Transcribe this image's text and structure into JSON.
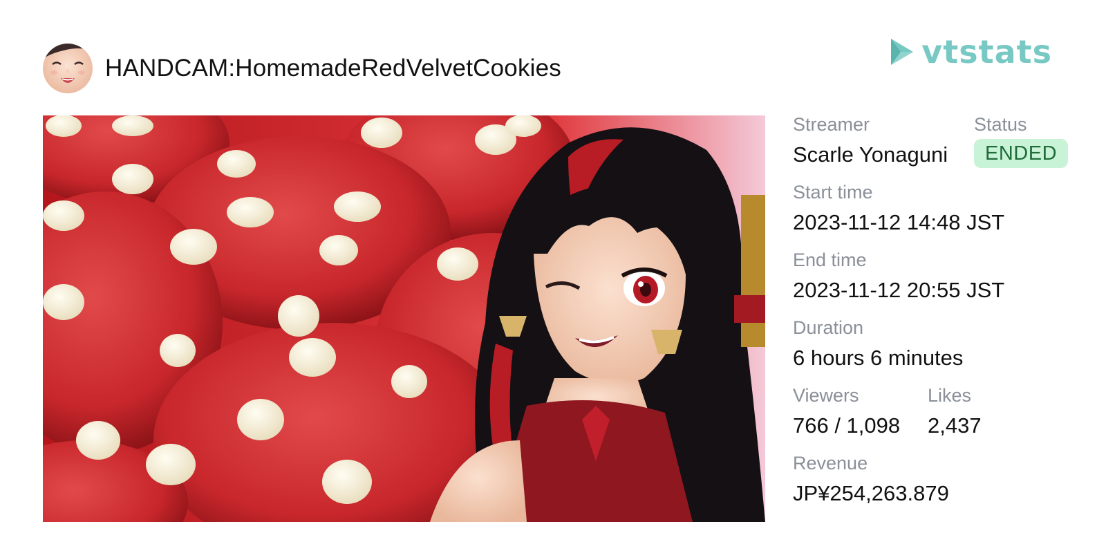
{
  "header": {
    "title": "HANDCAM:HomemadeRedVelvetCookies",
    "avatar_icon": "streamer-avatar"
  },
  "brand": {
    "name": "vtstats",
    "icon": "play-logo-icon",
    "color": "#78c9c4"
  },
  "thumbnail": {
    "description_icon": "stream-thumbnail"
  },
  "info": {
    "streamer_label": "Streamer",
    "streamer_value": "Scarle Yonaguni",
    "status_label": "Status",
    "status_value": "ENDED",
    "status_color": "#c9f3d6",
    "start_label": "Start time",
    "start_value": "2023-11-12 14:48 JST",
    "end_label": "End time",
    "end_value": "2023-11-12 20:55 JST",
    "duration_label": "Duration",
    "duration_value": "6 hours 6 minutes",
    "viewers_label": "Viewers",
    "viewers_value": "766 / 1,098",
    "likes_label": "Likes",
    "likes_value": "2,437",
    "revenue_label": "Revenue",
    "revenue_value": "JP¥254,263.879"
  }
}
